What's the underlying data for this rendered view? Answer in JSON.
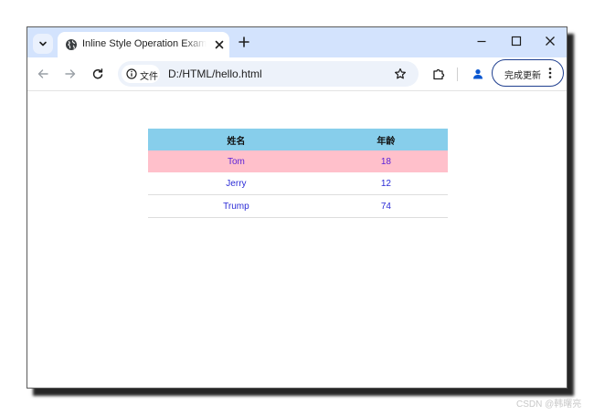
{
  "browser": {
    "tab": {
      "title": "Inline Style Operation Example"
    },
    "omnibox": {
      "security_chip_label": "文件",
      "url": "D:/HTML/hello.html"
    },
    "update_button": {
      "label": "完成更新"
    }
  },
  "page": {
    "table": {
      "headers": [
        "姓名",
        "年龄"
      ],
      "rows": [
        {
          "name": "Tom",
          "age": "18"
        },
        {
          "name": "Jerry",
          "age": "12"
        },
        {
          "name": "Trump",
          "age": "74"
        }
      ]
    }
  },
  "watermark": "CSDN @韩曙亮",
  "colors": {
    "tabstrip": "#d3e3fd",
    "table_header_bg": "#87ceeb",
    "highlight_row_bg": "#ffc0cb",
    "cell_text": "#2b2bd6"
  },
  "icons": {
    "tab_search": "chevron-down-icon",
    "favicon": "globe-icon",
    "tab_close": "close-icon",
    "new_tab": "plus-icon",
    "minimize": "minimize-icon",
    "maximize": "maximize-icon",
    "close_window": "close-icon",
    "back": "arrow-left-icon",
    "forward": "arrow-right-icon",
    "reload": "reload-icon",
    "info": "info-icon",
    "bookmark": "star-icon",
    "extensions": "puzzle-icon",
    "profile": "person-icon",
    "menu": "kebab-menu-icon"
  }
}
